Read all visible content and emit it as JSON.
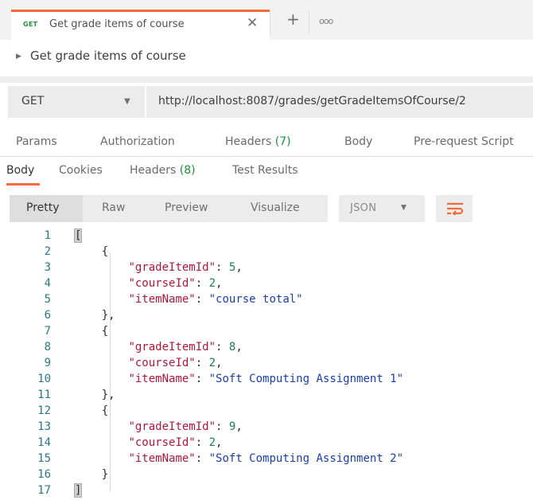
{
  "tab": {
    "method": "GET",
    "title": "Get grade items of course",
    "close_glyph": "✕",
    "new_tab_glyph": "+",
    "more_glyph": "ooo"
  },
  "request": {
    "name": "Get grade items of course",
    "method": "GET",
    "url": "http://localhost:8087/grades/getGradeItemsOfCourse/2"
  },
  "request_tabs": [
    {
      "label": "Params"
    },
    {
      "label": "Authorization"
    },
    {
      "label": "Headers",
      "count": "(7)"
    },
    {
      "label": "Body"
    },
    {
      "label": "Pre-request Script"
    }
  ],
  "response_tabs": [
    {
      "label": "Body",
      "active": true
    },
    {
      "label": "Cookies"
    },
    {
      "label": "Headers",
      "count": "(8)"
    },
    {
      "label": "Test Results"
    }
  ],
  "view_modes": [
    "Pretty",
    "Raw",
    "Preview",
    "Visualize"
  ],
  "selected_view": "Pretty",
  "format": "JSON",
  "response_body": [
    {
      "gradeItemId": 5,
      "courseId": 2,
      "itemName": "course total"
    },
    {
      "gradeItemId": 8,
      "courseId": 2,
      "itemName": "Soft Computing Assignment 1"
    },
    {
      "gradeItemId": 9,
      "courseId": 2,
      "itemName": "Soft Computing Assignment 2"
    }
  ],
  "line_numbers": [
    "1",
    "2",
    "3",
    "4",
    "5",
    "6",
    "7",
    "8",
    "9",
    "10",
    "11",
    "12",
    "13",
    "14",
    "15",
    "16",
    "17"
  ],
  "code_lines": [
    "[",
    "    {",
    "        \"gradeItemId\": 5,",
    "        \"courseId\": 2,",
    "        \"itemName\": \"course total\"",
    "    },",
    "    {",
    "        \"gradeItemId\": 8,",
    "        \"courseId\": 2,",
    "        \"itemName\": \"Soft Computing Assignment 1\"",
    "    },",
    "    {",
    "        \"gradeItemId\": 9,",
    "        \"courseId\": 2,",
    "        \"itemName\": \"Soft Computing Assignment 2\"",
    "    }",
    "]"
  ],
  "colors": {
    "accent": "#f26b3a",
    "method_green": "#1e8f3a",
    "json_key": "#b0173a",
    "json_number": "#1e7a57",
    "json_string": "#1a3fa8"
  }
}
